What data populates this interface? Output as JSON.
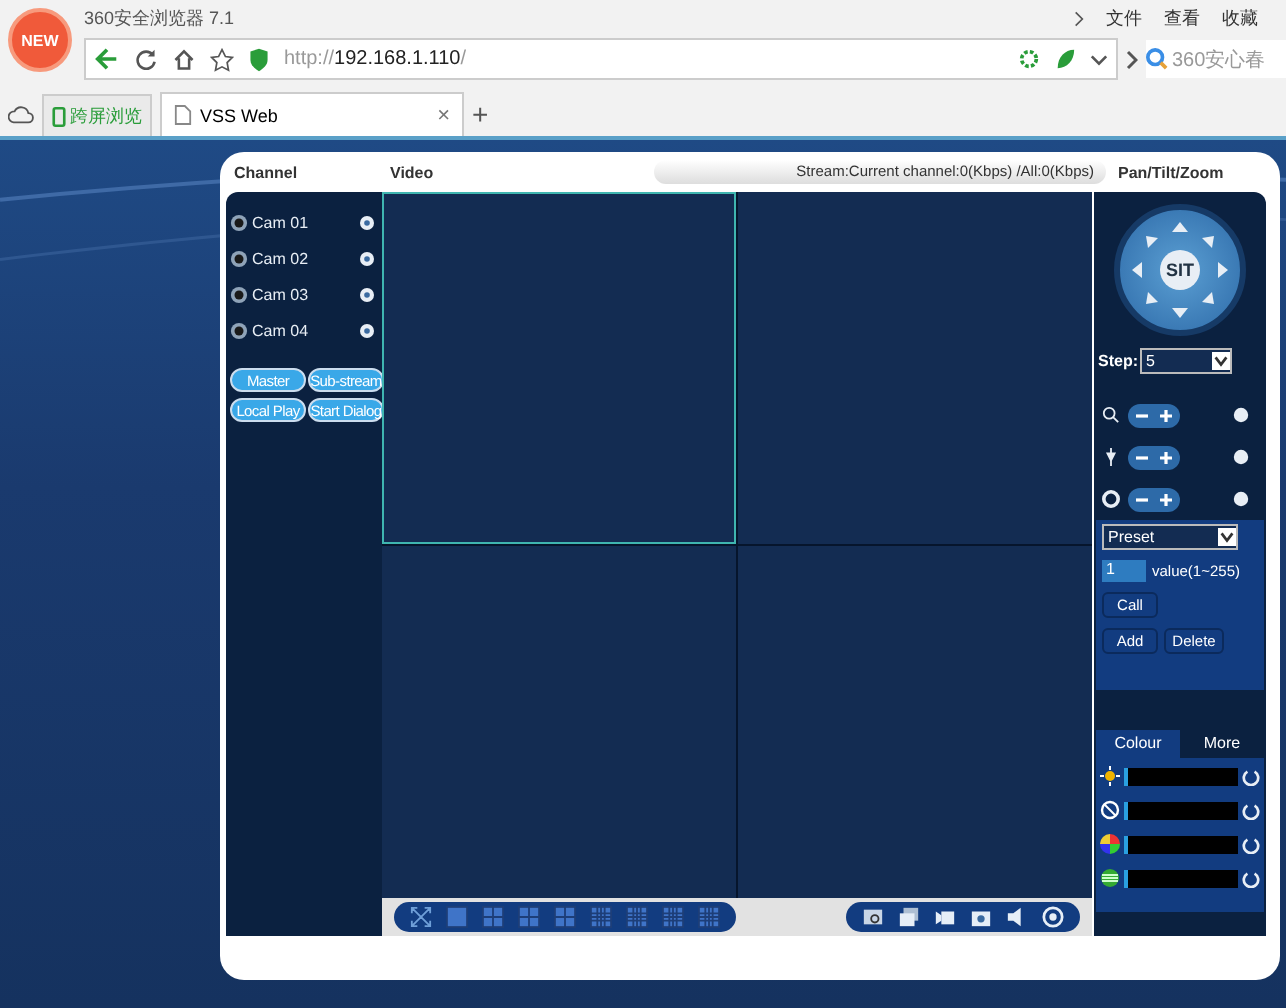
{
  "browser": {
    "logo": "NEW",
    "title": "360安全浏览器 7.1",
    "menu": [
      "文件",
      "查看",
      "收藏"
    ],
    "url_scheme": "http://",
    "url_host": "192.168.1.110",
    "url_tail": "/",
    "search_placeholder": "360安心春",
    "cross_screen_button": "跨屏浏览",
    "tabs": [
      {
        "label": "VSS Web",
        "selected": true,
        "close": "×"
      }
    ],
    "new_tab": "+"
  },
  "app": {
    "channel_heading": "Channel",
    "video_heading": "Video",
    "stream_status": "Stream:Current channel:0(Kbps) /All:0(Kbps)",
    "ptz_heading": "Pan/Tilt/Zoom",
    "channels": [
      {
        "name": "Cam 01"
      },
      {
        "name": "Cam 02"
      },
      {
        "name": "Cam 03"
      },
      {
        "name": "Cam 04"
      }
    ],
    "channel_buttons": [
      "Master",
      "Sub-stream",
      "Local Play",
      "Start Dialog"
    ],
    "video_panes": [
      {
        "selected": true
      },
      {
        "selected": false
      },
      {
        "selected": false
      },
      {
        "selected": false
      }
    ],
    "ptz": {
      "center": "SIT",
      "step_label": "Step:",
      "step_value": "5",
      "preset_select": "Preset",
      "preset_number": "1",
      "preset_range": "value(1~255)",
      "buttons": [
        "Call",
        "Add",
        "Delete"
      ]
    },
    "image_tabs": [
      {
        "label": "Colour",
        "selected": true
      },
      {
        "label": "More",
        "selected": false
      }
    ],
    "image_sliders": [
      {
        "kind": "brightness",
        "level": 0.03
      },
      {
        "kind": "contrast",
        "level": 0.03
      },
      {
        "kind": "saturation",
        "level": 0.03
      },
      {
        "kind": "hue",
        "level": 0.03
      }
    ]
  }
}
